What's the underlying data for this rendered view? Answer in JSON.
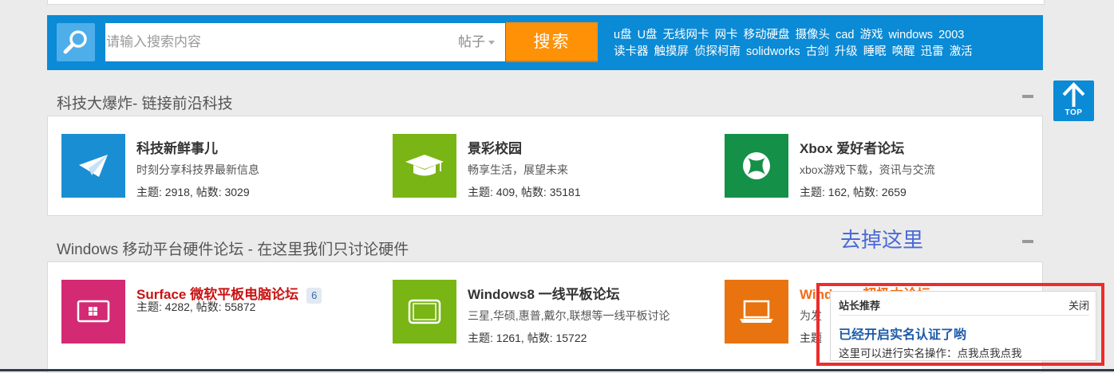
{
  "search": {
    "placeholder": "请输入搜索内容",
    "type_label": "帖子",
    "button_label": "搜索",
    "hot_links_row1": [
      "u盘",
      "U盘",
      "无线网卡",
      "网卡",
      "移动硬盘",
      "摄像头",
      "cad",
      "游戏",
      "windows",
      "2003"
    ],
    "hot_links_row2": [
      "读卡器",
      "触摸屏",
      "侦探柯南",
      "solidworks",
      "古剑",
      "升级",
      "睡眠",
      "唤醒",
      "迅雷",
      "激活"
    ]
  },
  "top_button": {
    "label": "TOP",
    "icon": "up-arrow-icon"
  },
  "sections": [
    {
      "title": "科技大爆炸- 链接前沿科技",
      "forums": [
        {
          "name": "科技新鲜事儿",
          "desc": "时刻分享科技界最新信息",
          "stats": "主题: 2918, 帖数: 3029",
          "icon": "paper-plane-icon",
          "color": "#1a8ed3"
        },
        {
          "name": "景彩校园",
          "desc": "畅享生活，展望未来",
          "stats": "主题: 409, 帖数: 35181",
          "icon": "graduation-cap-icon",
          "color": "#79b514"
        },
        {
          "name": "Xbox 爱好者论坛",
          "desc": "xbox游戏下载，资讯与交流",
          "stats": "主题: 162, 帖数: 2659",
          "icon": "xbox-icon",
          "color": "#159048"
        }
      ]
    },
    {
      "title": "Windows 移动平台硬件论坛 - 在这里我们只讨论硬件",
      "forums": [
        {
          "name": "Surface 微软平板电脑论坛",
          "badge": "6",
          "desc": "",
          "stats": "主题: 4282, 帖数: 55872",
          "icon": "surface-tablet-icon",
          "color": "#d32a73"
        },
        {
          "name": "Windows8 一线平板论坛",
          "desc": "三星,华硕,惠普,戴尔,联想等一线平板讨论",
          "stats": "主题: 1261, 帖数: 15722",
          "icon": "tablet-icon",
          "color": "#79b514"
        },
        {
          "name": "Windows 超极本论坛",
          "desc": "为发",
          "stats": "主题",
          "icon": "laptop-icon",
          "color": "#e8730f"
        }
      ]
    }
  ],
  "annotation": "去掉这里",
  "popup": {
    "title": "站长推荐",
    "close_label": "关闭",
    "headline": "已经开启实名认证了哟",
    "body": "这里可以进行实名操作：点我点我点我"
  },
  "colors": {
    "brand_blue": "#0b8ad5",
    "search_orange": "#ff9106",
    "highlight_red": "#ee2c2c"
  }
}
